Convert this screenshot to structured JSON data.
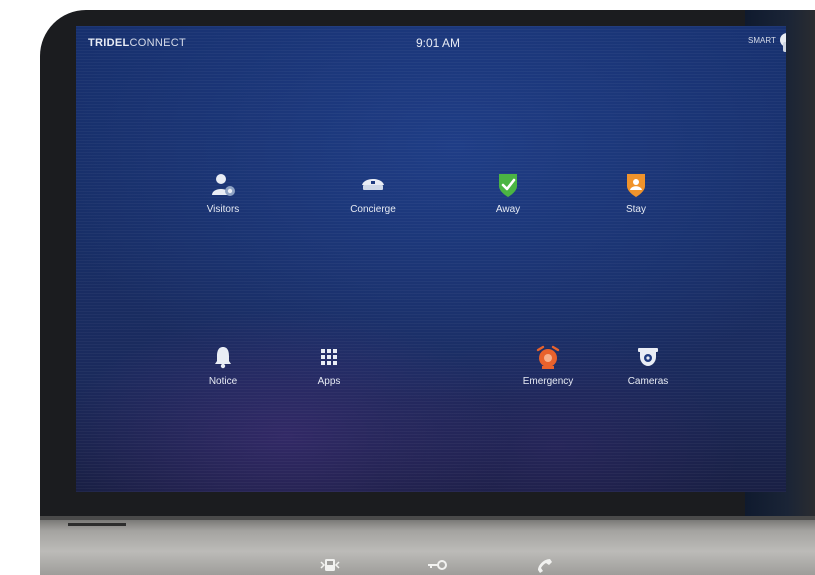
{
  "header": {
    "brand_bold": "TRIDEL",
    "brand_light": "CONNECT",
    "time": "9:01 AM",
    "smart_label": "SMART"
  },
  "tiles": [
    {
      "label": "Visitors",
      "icon": "visitors-icon"
    },
    {
      "label": "Concierge",
      "icon": "concierge-icon"
    },
    {
      "label": "Away",
      "icon": "shield-check-icon"
    },
    {
      "label": "Stay",
      "icon": "shield-person-icon"
    },
    {
      "label": "Notice",
      "icon": "bell-icon"
    },
    {
      "label": "Apps",
      "icon": "grid-icon"
    },
    {
      "label": "Emergency",
      "icon": "alarm-icon"
    },
    {
      "label": "Cameras",
      "icon": "camera-icon"
    }
  ],
  "hardware_buttons": [
    "intercom-icon",
    "key-icon",
    "phone-icon"
  ],
  "colors": {
    "away": "#4bb543",
    "stay": "#f0932b",
    "emergency": "#e8622c",
    "background": "#182e66"
  }
}
